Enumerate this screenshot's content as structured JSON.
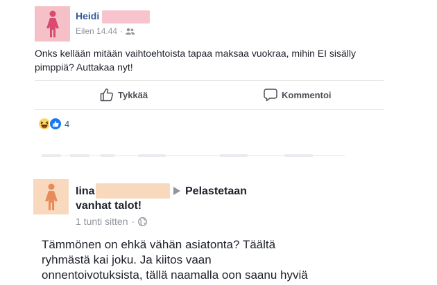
{
  "post1": {
    "author": "Heidi",
    "time": "Eilen 14.44",
    "privacy_separator": "·",
    "body": "Onks kellään mitään vaihtoehtoista tapaa maksaa vuokraa, mihin EI sisälly pimppiä? Auttakaa nyt!",
    "like_label": "Tykkää",
    "comment_label": "Kommentoi",
    "reaction_count": "4"
  },
  "post2": {
    "author": "Iina",
    "group_line1": "Pelastetaan",
    "group_line2": "vanhat talot!",
    "time": "1 tunti sitten",
    "privacy_separator": "·",
    "body_line1": "Tämmönen on ehkä vähän asiatonta? Täältä",
    "body_line2": "ryhmästä kai joku. Ja kiitos vaan",
    "body_line3": "onnentoivotuksista, tällä naamalla oon saanu hyviä"
  },
  "colors": {
    "name_link": "#365899",
    "meta_gray": "#90949c",
    "avatar_pink": "#f6c0c8",
    "avatar_peach": "#f8d9bd",
    "figure_red": "#d84a6e",
    "figure_orange": "#e98a5a"
  }
}
